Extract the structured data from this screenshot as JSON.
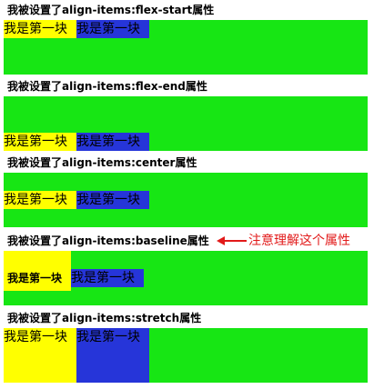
{
  "sections": [
    {
      "title": "我被设置了align-items:flex-start属性",
      "item1": "我是第一块",
      "item2": "我是第一块"
    },
    {
      "title": "我被设置了align-items:flex-end属性",
      "item1": "我是第一块",
      "item2": "我是第一块"
    },
    {
      "title": "我被设置了align-items:center属性",
      "item1": "我是第一块",
      "item2": "我是第一块"
    },
    {
      "title": "我被设置了align-items:baseline属性",
      "item1": "我是第一块",
      "item2": "我是第一块"
    },
    {
      "title": "我被设置了align-items:stretch属性",
      "item1": "我是第一块",
      "item2": "我是第一块"
    }
  ],
  "annotation": {
    "text": "注意理解这个属性",
    "color": "#e21a1a"
  },
  "colors": {
    "container": "#17e614",
    "yellow_block": "#ffff00",
    "blue_block": "#2635d9"
  }
}
